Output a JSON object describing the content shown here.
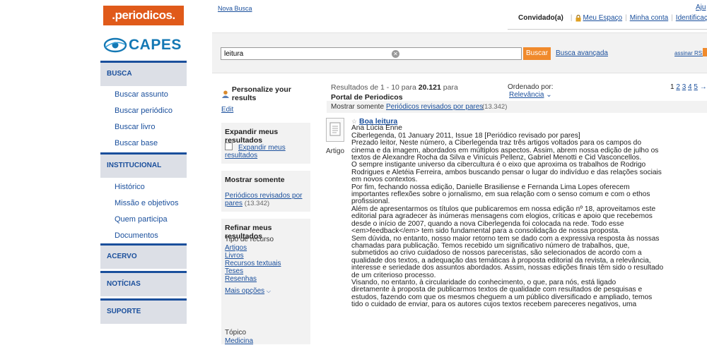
{
  "sidebar": {
    "logo_periodicos": ".periodicos.",
    "logo_capes": "CAPES",
    "sections": [
      {
        "label": "BUSCA"
      },
      {
        "label": "INSTITUCIONAL"
      },
      {
        "label": "ACERVO"
      },
      {
        "label": "NOTÍCIAS"
      },
      {
        "label": "SUPORTE"
      }
    ],
    "busca_items": [
      "Buscar assunto",
      "Buscar periódico",
      "Buscar livro",
      "Buscar base"
    ],
    "institucional_items": [
      "Histórico",
      "Missão e objetivos",
      "Quem participa",
      "Documentos"
    ]
  },
  "header": {
    "nova_busca": "Nova Busca",
    "convidado": "Convidado(a)",
    "meu_espaco": "Meu Espaço",
    "minha_conta": "Minha conta",
    "identificacao": "Identificação",
    "ajuda": "Aju"
  },
  "search": {
    "value": "leitura",
    "button": "Buscar",
    "advanced": "Busca avançada",
    "rss": "assinar RSS"
  },
  "facets": {
    "personalize": "Personalize your results",
    "edit": "Edit",
    "expandir_title": "Expandir meus resultados",
    "expandir_checkbox": "Expandir meus resultados",
    "mostrar_title": "Mostrar somente",
    "mostrar_link": "Periódicos revisados por pares",
    "mostrar_count": "(13.342)",
    "refinar_title": "Refinar meus resultados",
    "tipo_label": "Tipo de recurso",
    "tipo_items": [
      "Artigos",
      "Livros",
      "Recursos textuais",
      "Teses",
      "Resenhas"
    ],
    "mais_opcoes": "Mais opções",
    "topico_label": "Tópico",
    "topico_first": "Medicina"
  },
  "results": {
    "summary_prefix": "Resultados de 1 - 10 para",
    "total": "20.121",
    "summary_para": "para",
    "source": "Portal de Periodicos",
    "ordenado": "Ordenado por:",
    "relevancia": "Relevância",
    "pages": [
      "1",
      "2",
      "3",
      "4",
      "5"
    ],
    "mostrar_label": "Mostrar somente",
    "mostrar_link": "Periódicos revisados por pares",
    "mostrar_count": "(13.342)"
  },
  "item": {
    "type_label": "Artigo",
    "title": "Boa leitura",
    "author": "Ana Lúcia Enne",
    "citation": "Ciberlegenda, 01 January 2011, Issue 18 [Periódico revisado por pares]",
    "abstract": [
      "Prezado leitor, Neste número, a Ciberlegenda traz três artigos voltados para os campos do",
      "cinema e da imagem, abordados em múltiplos aspectos. Assim, abrem nossa edição de julho os",
      "textos de Alexandre Rocha da Silva e Vinícuis Pellenz, Gabriel Menotti e Cid Vasconcellos.",
      "O sempre instigante universo da cibercultura é o eixo que aproxima os trabalhos de Rodrigo",
      "Rodrigues e Aletéia Ferreira, ambos buscando pensar o lugar do indivíduo e das relações sociais",
      "em novos contextos.",
      "Por fim, fechando nossa edição, Danielle Brasiliense e Fernanda Lima Lopes oferecem",
      "importantes reflexões sobre o jornalismo, em sua relação com o senso comum e com o ethos",
      "profissional.",
      "Além de apresentarmos os títulos que publicaremos em nossa edição nº 18, aproveitamos este",
      "editorial para agradecer às inúmeras mensagens com elogios, críticas e apoio que recebemos",
      "desde o início de 2007, quando a nova Ciberlegenda foi colocada na rede. Todo esse",
      "<em>feedback</em> tem sido fundamental para a consolidação de nossa proposta.",
      "Sem dúvida, no entanto, nosso maior retorno tem se dado com a expressiva resposta às nossas",
      "chamadas para publicação. Temos recebido um significativo número de trabalhos, que,",
      "submetidos ao crivo cuidadoso de nossos pareceristas, são selecionados de acordo com a",
      "qualidade dos textos, a adequação das temáticas à proposta editorial da revista, a relevância,",
      "interesse e seriedade dos assuntos abordados. Assim, nossas edições finais têm sido o resultado",
      "de um criterioso processo.",
      "Visando, no entanto, à circularidade do conhecimento, o que, para nós, está ligado",
      "diretamente à proposta de publicarmos textos de qualidade com resultados de pesquisas e",
      "estudos, fazendo com que os mesmos cheguem a um público diversificado e ampliado, temos",
      "tido o cuidado de enviar, para os autores cujos textos recebem pareceres negativos, uma"
    ]
  }
}
